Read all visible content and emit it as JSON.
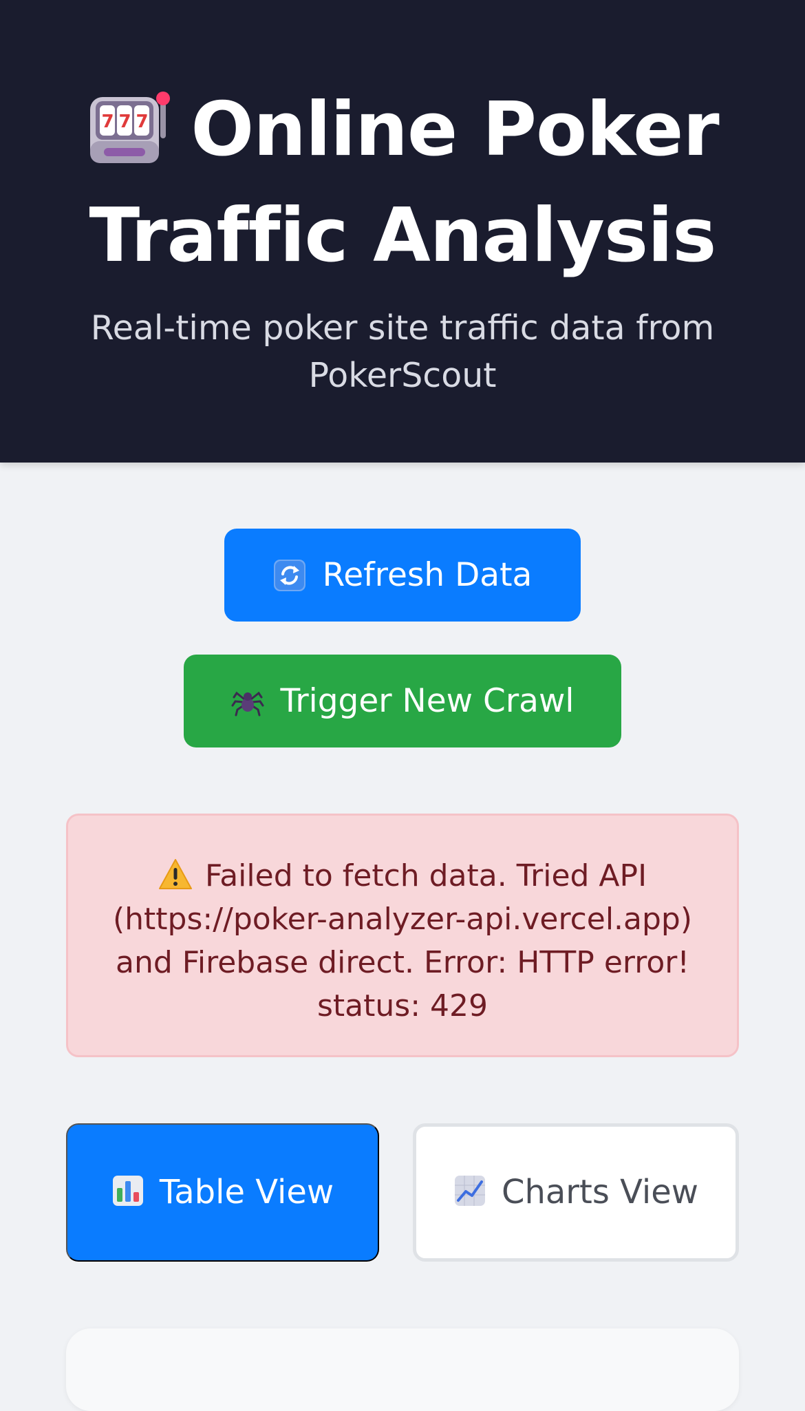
{
  "header": {
    "title": "Online Poker Traffic Analysis",
    "title_icon": "slot-machine-icon",
    "subtitle": "Real-time poker site traffic data from PokerScout"
  },
  "actions": {
    "refresh_label": "Refresh Data",
    "refresh_icon": "refresh-arrows-icon",
    "crawl_label": "Trigger New Crawl",
    "crawl_icon": "spider-icon"
  },
  "error": {
    "icon": "warning-icon",
    "message": "Failed to fetch data. Tried API (https://poker-analyzer-api.vercel.app) and Firebase direct. Error: HTTP error! status: 429"
  },
  "view_tabs": {
    "table_label": "Table View",
    "table_icon": "bar-chart-icon",
    "charts_label": "Charts View",
    "charts_icon": "line-chart-icon",
    "active": "table"
  },
  "colors": {
    "header_bg": "#1a1c2e",
    "primary": "#0a7cff",
    "success": "#28a745",
    "error_bg": "#f8d7da",
    "error_text": "#6e1c24"
  }
}
